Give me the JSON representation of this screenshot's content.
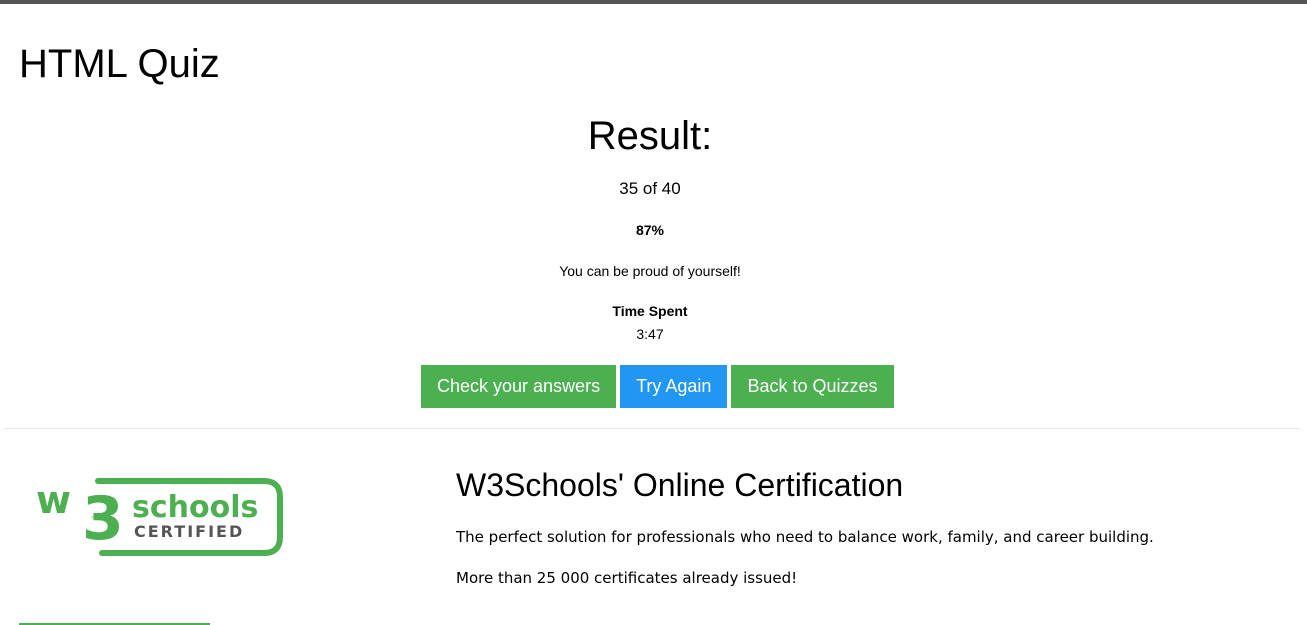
{
  "page": {
    "title": "HTML Quiz"
  },
  "result": {
    "heading": "Result:",
    "score_text": "35 of 40",
    "percent_text": "87%",
    "message": "You can be proud of yourself!",
    "time_label": "Time Spent",
    "time_value": "3:47"
  },
  "actions": {
    "check_answers": "Check your answers",
    "try_again": "Try Again",
    "back_to_quizzes": "Back to Quizzes"
  },
  "certification": {
    "logo_text_top": "schools",
    "logo_text_bottom": "CERTIFIED",
    "logo_w": "w",
    "logo_3": "3",
    "logo_tm": "™",
    "heading": "W3Schools' Online Certification",
    "line1": "The perfect solution for professionals who need to balance work, family, and career building.",
    "line2": "More than 25 000 certificates already issued!"
  },
  "colors": {
    "green": "#4caf50",
    "blue": "#2196f3",
    "top_bar": "#555555"
  }
}
